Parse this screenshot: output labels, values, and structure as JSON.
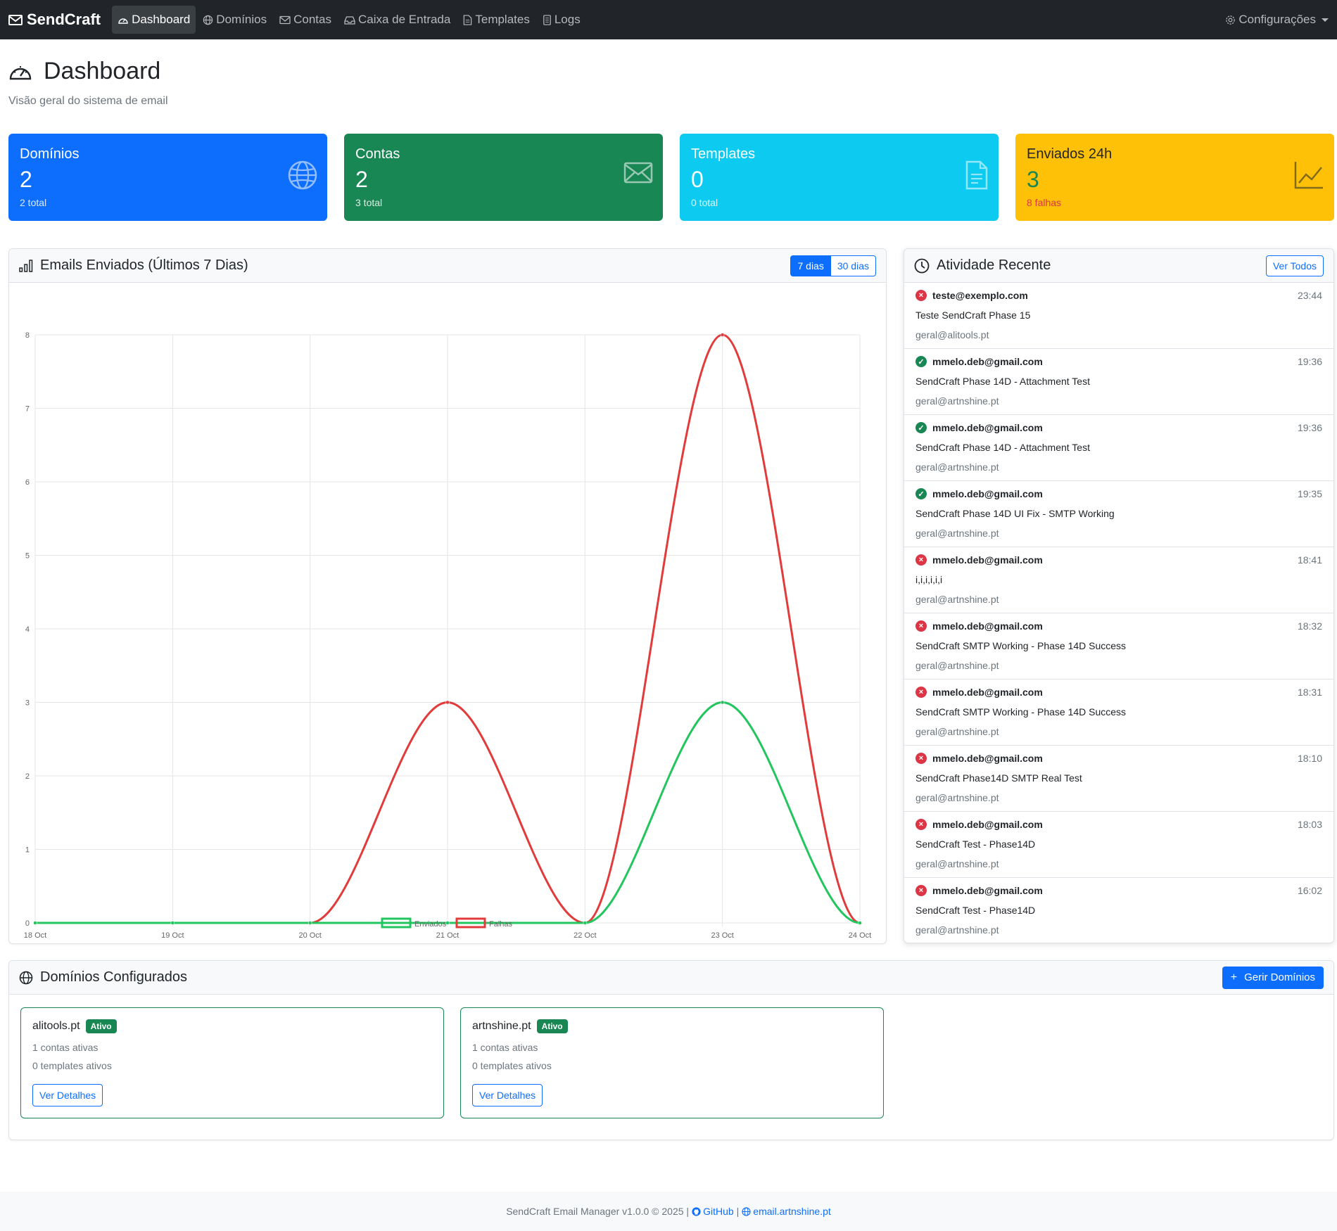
{
  "nav": {
    "brand": "SendCraft",
    "items": [
      {
        "label": "Dashboard",
        "icon": "speedometer-icon",
        "active": true
      },
      {
        "label": "Domínios",
        "icon": "globe-icon"
      },
      {
        "label": "Contas",
        "icon": "envelope-icon"
      },
      {
        "label": "Caixa de Entrada",
        "icon": "inbox-icon"
      },
      {
        "label": "Templates",
        "icon": "file-icon"
      },
      {
        "label": "Logs",
        "icon": "journal-icon"
      }
    ],
    "settings": "Configurações"
  },
  "header": {
    "title": "Dashboard",
    "subtitle": "Visão geral do sistema de email"
  },
  "stats": [
    {
      "label": "Domínios",
      "value": "2",
      "sub": "2 total",
      "color": "#0d6efd",
      "icon": "globe-icon"
    },
    {
      "label": "Contas",
      "value": "2",
      "sub": "3 total",
      "color": "#198754",
      "icon": "envelope-icon"
    },
    {
      "label": "Templates",
      "value": "0",
      "sub": "0 total",
      "color": "#0dcaf0",
      "icon": "file-text-icon"
    },
    {
      "label": "Enviados 24h",
      "value": "3",
      "sub": "8 falhas",
      "color": "#ffc107",
      "icon": "graph-up-icon"
    }
  ],
  "chart_card": {
    "title": "Emails Enviados (Últimos 7 Dias)",
    "btn_7": "7 dias",
    "btn_30": "30 dias"
  },
  "chart_data": {
    "type": "line",
    "categories": [
      "18 Oct",
      "19 Oct",
      "20 Oct",
      "21 Oct",
      "22 Oct",
      "23 Oct",
      "24 Oct"
    ],
    "series": [
      {
        "name": "Enviados",
        "values": [
          0,
          0,
          0,
          0,
          0,
          3,
          0
        ],
        "color": "#22c55e"
      },
      {
        "name": "Falhas",
        "values": [
          0,
          0,
          0,
          3,
          0,
          8,
          0
        ],
        "color": "#e23b3b"
      }
    ],
    "yticks": [
      "0",
      "1",
      "2",
      "3",
      "4",
      "5",
      "6",
      "7",
      "8"
    ],
    "ylim": [
      0,
      8
    ],
    "grid": true,
    "legend": "bottom"
  },
  "activity": {
    "title": "Atividade Recente",
    "view_all": "Ver Todos",
    "items": [
      {
        "status": "error",
        "to": "teste@exemplo.com",
        "time": "23:44",
        "subject": "Teste SendCraft Phase 15",
        "from": "geral@alitools.pt"
      },
      {
        "status": "success",
        "to": "mmelo.deb@gmail.com",
        "time": "19:36",
        "subject": "SendCraft Phase 14D - Attachment Test",
        "from": "geral@artnshine.pt"
      },
      {
        "status": "success",
        "to": "mmelo.deb@gmail.com",
        "time": "19:36",
        "subject": "SendCraft Phase 14D - Attachment Test",
        "from": "geral@artnshine.pt"
      },
      {
        "status": "success",
        "to": "mmelo.deb@gmail.com",
        "time": "19:35",
        "subject": "SendCraft Phase 14D UI Fix - SMTP Working",
        "from": "geral@artnshine.pt"
      },
      {
        "status": "error",
        "to": "mmelo.deb@gmail.com",
        "time": "18:41",
        "subject": "i,i,i,i,i,i",
        "from": "geral@artnshine.pt"
      },
      {
        "status": "error",
        "to": "mmelo.deb@gmail.com",
        "time": "18:32",
        "subject": "SendCraft SMTP Working - Phase 14D Success",
        "from": "geral@artnshine.pt"
      },
      {
        "status": "error",
        "to": "mmelo.deb@gmail.com",
        "time": "18:31",
        "subject": "SendCraft SMTP Working - Phase 14D Success",
        "from": "geral@artnshine.pt"
      },
      {
        "status": "error",
        "to": "mmelo.deb@gmail.com",
        "time": "18:10",
        "subject": "SendCraft Phase14D SMTP Real Test",
        "from": "geral@artnshine.pt"
      },
      {
        "status": "error",
        "to": "mmelo.deb@gmail.com",
        "time": "18:03",
        "subject": "SendCraft Test - Phase14D",
        "from": "geral@artnshine.pt"
      },
      {
        "status": "error",
        "to": "mmelo.deb@gmail.com",
        "time": "16:02",
        "subject": "SendCraft Test - Phase14D",
        "from": "geral@artnshine.pt"
      }
    ]
  },
  "domains": {
    "title": "Domínios Configurados",
    "manage": "Gerir Domínios",
    "items": [
      {
        "name": "alitools.pt",
        "badge": "Ativo",
        "accounts": "1 contas ativas",
        "templates": "0 templates ativos",
        "button": "Ver Detalhes"
      },
      {
        "name": "artnshine.pt",
        "badge": "Ativo",
        "accounts": "1 contas ativas",
        "templates": "0 templates ativos",
        "button": "Ver Detalhes"
      }
    ]
  },
  "footer": {
    "text": "SendCraft Email Manager v1.0.0 © 2025 |",
    "github": "GitHub",
    "sep": "|",
    "site": "email.artnshine.pt"
  }
}
